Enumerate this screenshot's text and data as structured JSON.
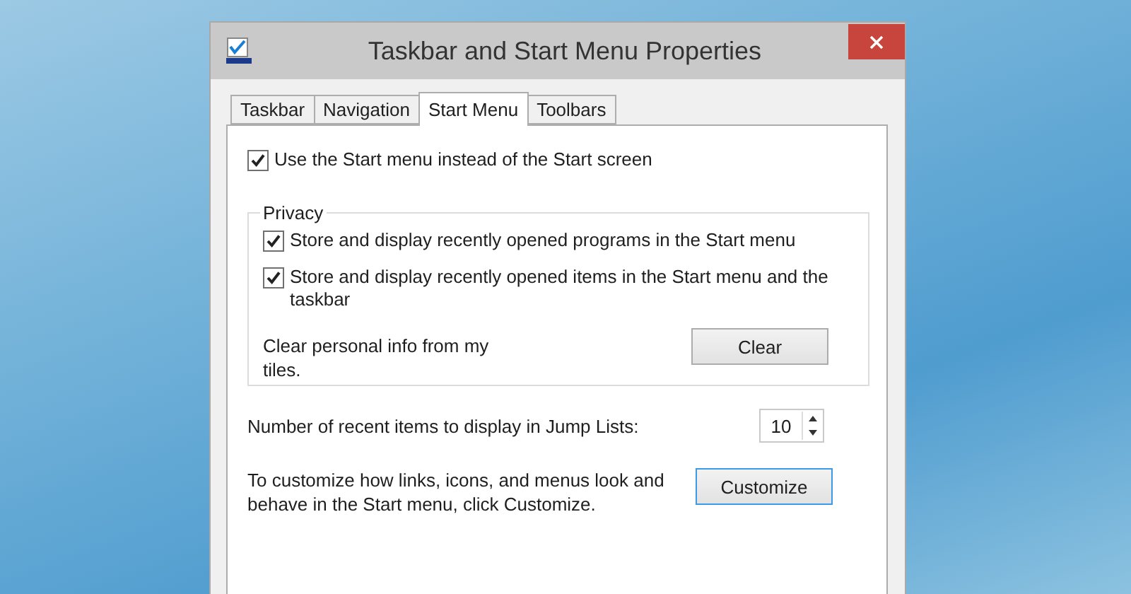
{
  "window": {
    "title": "Taskbar and Start Menu Properties"
  },
  "tabs": [
    {
      "label": "Taskbar",
      "selected": false
    },
    {
      "label": "Navigation",
      "selected": false
    },
    {
      "label": "Start Menu",
      "selected": true
    },
    {
      "label": "Toolbars",
      "selected": false
    }
  ],
  "start_menu_option": {
    "label": "Use the Start menu instead of the Start screen",
    "checked": true
  },
  "privacy": {
    "title": "Privacy",
    "options": [
      {
        "label": "Store and display recently opened programs in the Start menu",
        "checked": true
      },
      {
        "label": "Store and display recently opened items in the Start menu and the taskbar",
        "checked": true
      }
    ],
    "clear_text": "Clear personal info from my tiles.",
    "clear_button": "Clear"
  },
  "jump_lists": {
    "label": "Number of recent items to display in Jump Lists:",
    "value": "10"
  },
  "customize": {
    "text": "To customize how links, icons, and menus look and behave in the Start menu, click Customize.",
    "button": "Customize"
  }
}
